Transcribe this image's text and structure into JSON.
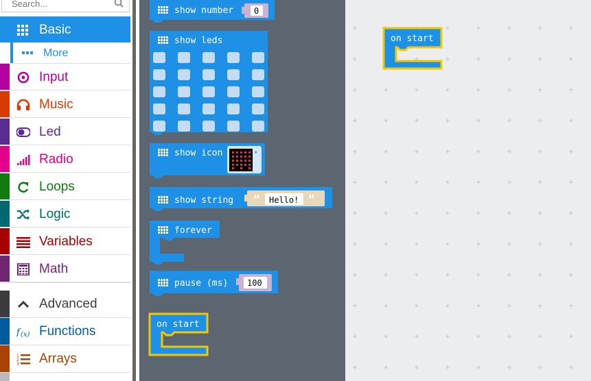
{
  "toolbox": {
    "search_placeholder": "Search...",
    "categories": [
      {
        "label": "Basic",
        "color": "#1e90e6",
        "icon": "grid-icon"
      },
      {
        "label": "More",
        "color": "#1e90e6",
        "icon": "ellipsis-icon"
      },
      {
        "label": "Input",
        "color": "#b4009e",
        "icon": "target-icon"
      },
      {
        "label": "Music",
        "color": "#d83b01",
        "icon": "headphones-icon"
      },
      {
        "label": "Led",
        "color": "#5c2d91",
        "icon": "toggle-icon"
      },
      {
        "label": "Radio",
        "color": "#e3008c",
        "icon": "signal-bars-icon"
      },
      {
        "label": "Loops",
        "color": "#107c10",
        "icon": "refresh-icon"
      },
      {
        "label": "Logic",
        "color": "#006970",
        "icon": "shuffle-icon"
      },
      {
        "label": "Variables",
        "color": "#a80000",
        "icon": "list-lines-icon"
      },
      {
        "label": "Math",
        "color": "#712672",
        "icon": "calculator-icon"
      },
      {
        "label": "Advanced",
        "color": "#3c3c3c",
        "icon": "chevron-up-icon"
      },
      {
        "label": "Functions",
        "color": "#005a9e",
        "icon": "function-icon"
      },
      {
        "label": "Arrays",
        "color": "#a94400",
        "icon": "numbered-list-icon"
      }
    ]
  },
  "flyout": {
    "show_number": {
      "label": "show number",
      "value": "0"
    },
    "show_leds": {
      "label": "show leds"
    },
    "show_icon": {
      "label": "show icon",
      "dropdown": "▾"
    },
    "show_string": {
      "label": "show string",
      "value": "Hello!",
      "open_quote": "“",
      "close_quote": "”"
    },
    "forever": {
      "label": "forever"
    },
    "pause": {
      "label": "pause (ms)",
      "value": "100"
    },
    "on_start": {
      "label": "on start"
    }
  },
  "workspace": {
    "on_start": {
      "label": "on start"
    }
  },
  "colors": {
    "block_blue": "#1e90e6",
    "highlight_yellow": "#f2c800",
    "flyout_bg": "#5c6670",
    "workspace_bg": "#ecedef"
  }
}
